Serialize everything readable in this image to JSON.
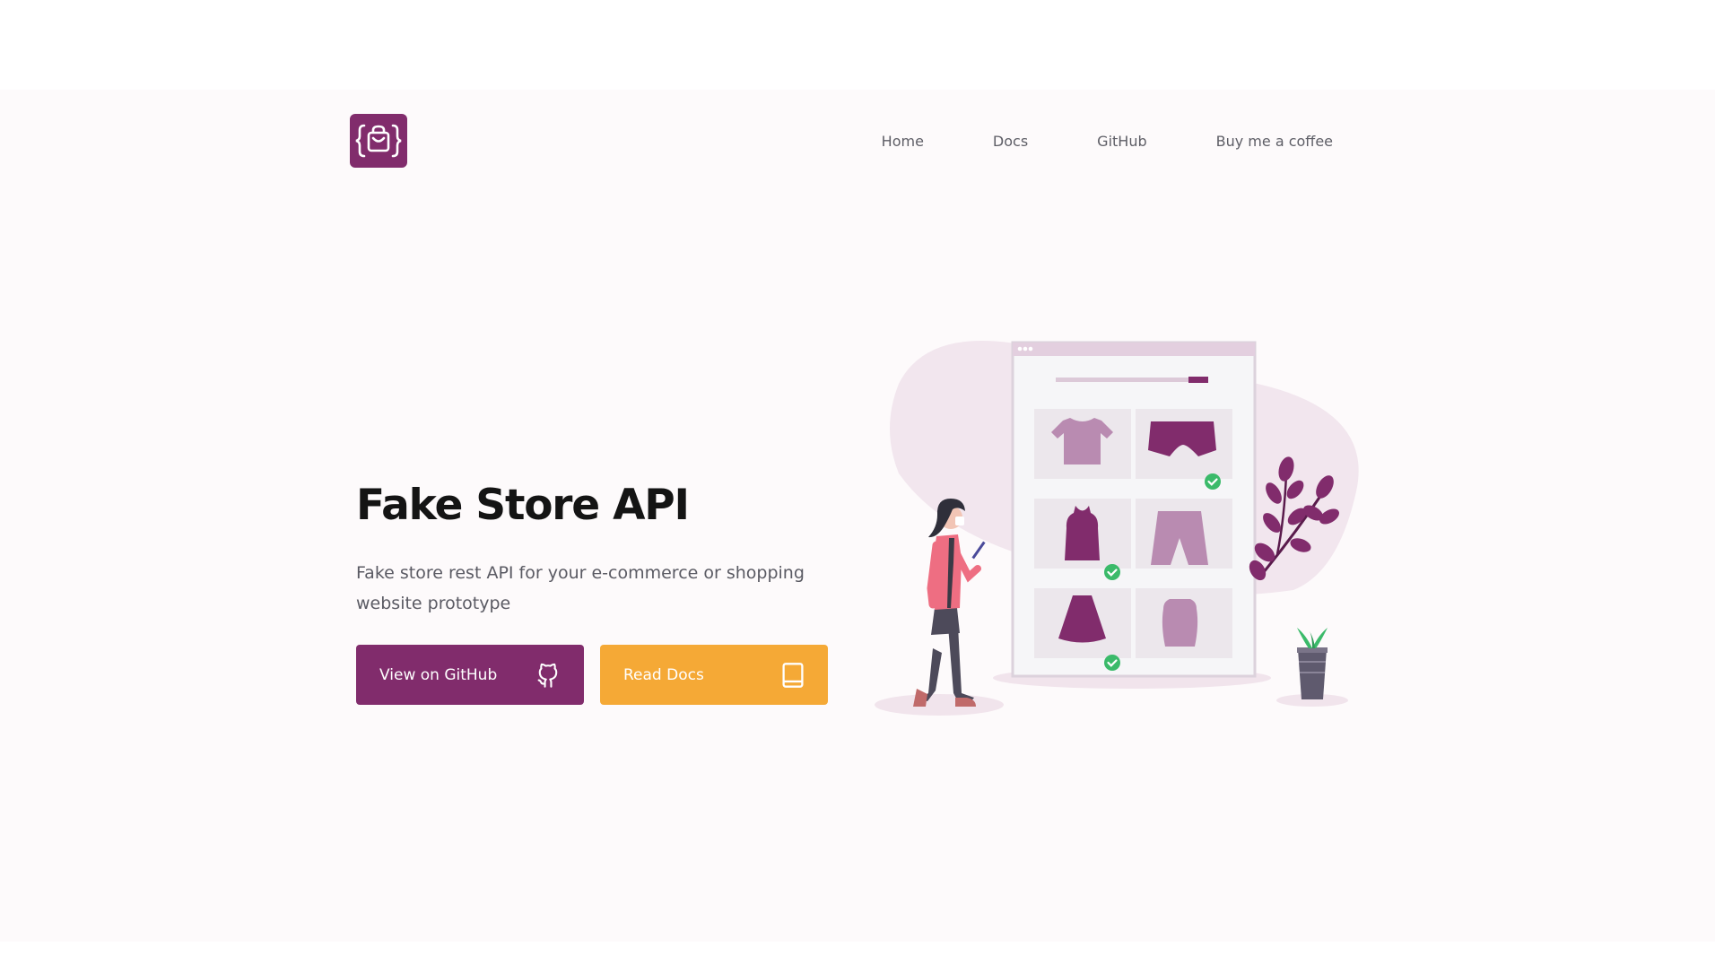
{
  "nav": {
    "logo_alt": "Fake Store API logo",
    "links": [
      {
        "label": "Home"
      },
      {
        "label": "Docs"
      },
      {
        "label": "GitHub"
      },
      {
        "label": "Buy me a coffee"
      }
    ]
  },
  "hero": {
    "title": "Fake Store API",
    "subtitle": "Fake store rest API for your e-commerce or shopping website prototype",
    "buttons": {
      "github": {
        "label": "View on GitHub",
        "icon": "github-icon"
      },
      "docs": {
        "label": "Read Docs",
        "icon": "book-icon"
      }
    }
  },
  "illustration": {
    "description_icon": "shopping-illustration"
  },
  "colors": {
    "brand_purple": "#812c6c",
    "accent_orange": "#f5a936",
    "background": "#fdfafb",
    "check_green": "#3bba6a"
  }
}
